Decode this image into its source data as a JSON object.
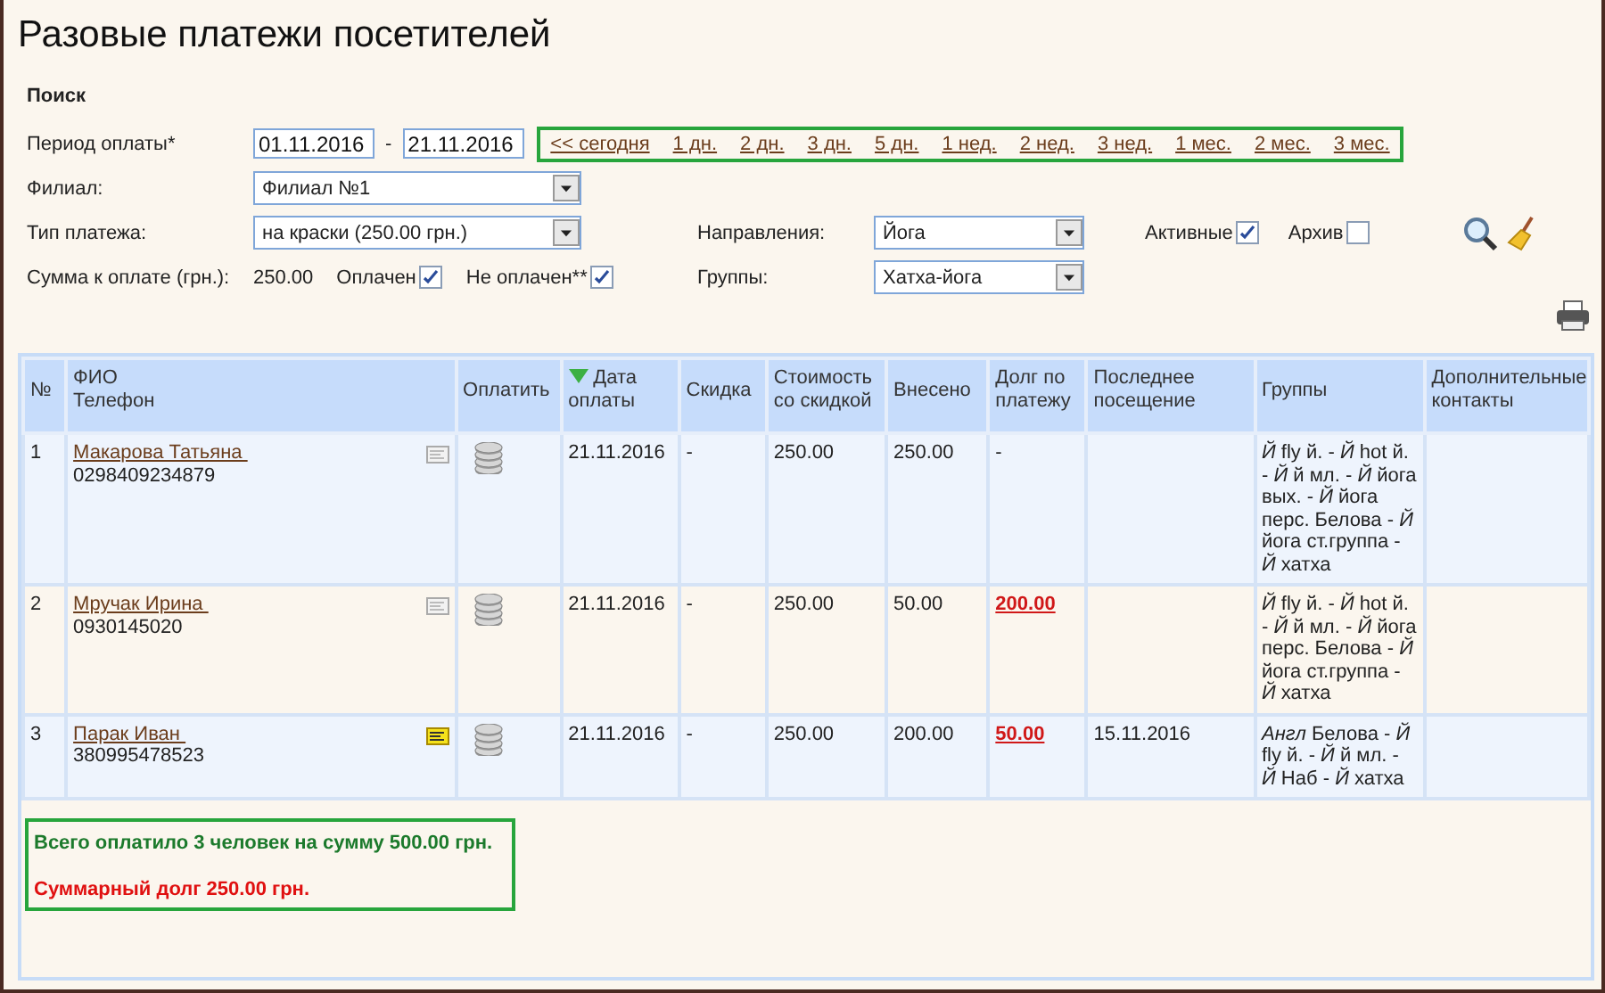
{
  "title": "Разовые платежи посетителей",
  "filters": {
    "heading": "Поиск",
    "period": {
      "label": "Период оплаты*",
      "from": "01.11.2016",
      "separator": "-",
      "to": "21.11.2016"
    },
    "quick_ranges": [
      "<<  сегодня",
      "1 дн.",
      "2 дн.",
      "3 дн.",
      "5 дн.",
      "1 нед.",
      "2 нед.",
      "3 нед.",
      "1 мес.",
      "2 мес.",
      "3 мес."
    ],
    "branch": {
      "label": "Филиал:",
      "value": "Филиал №1"
    },
    "payment_type": {
      "label": "Тип платежа:",
      "value": "на краски (250.00 грн.)"
    },
    "amount": {
      "label": "Сумма к оплате (грн.):",
      "value": "250.00"
    },
    "paid": {
      "label": "Оплачен",
      "checked": true
    },
    "unpaid": {
      "label": "Не оплачен**",
      "checked": true
    },
    "directions": {
      "label": "Направления:",
      "value": "Йога"
    },
    "groups": {
      "label": "Группы:",
      "value": "Хатха-йога"
    },
    "active": {
      "label": "Активные",
      "checked": true
    },
    "archive": {
      "label": "Архив",
      "checked": false
    }
  },
  "table": {
    "columns": [
      {
        "label": "№",
        "sorted": false
      },
      {
        "label": "ФИО\nТелефон",
        "sorted": false
      },
      {
        "label": "Оплатить",
        "sorted": false
      },
      {
        "label": "Дата оплаты",
        "sorted": true
      },
      {
        "label": "Скидка",
        "sorted": false
      },
      {
        "label": "Стоимость со скидкой",
        "sorted": false
      },
      {
        "label": "Внесено",
        "sorted": false
      },
      {
        "label": "Долг по платежу",
        "sorted": false
      },
      {
        "label": "Последнее посещение",
        "sorted": false
      },
      {
        "label": "Группы",
        "sorted": false
      },
      {
        "label": "Дополнительные контакты",
        "sorted": false
      }
    ],
    "rows": [
      {
        "number": "1",
        "name": "Макарова Татьяна ",
        "phone": "0298409234879",
        "has_note": false,
        "date": "21.11.2016",
        "discount": "-",
        "cost": "250.00",
        "paid": "250.00",
        "debt": {
          "text": "-",
          "highlighted": false
        },
        "last_visit": "",
        "groups": "*Й* fly й. - *Й* hot й. - *Й* й мл. - *Й* йога вых. - *Й* йога перс. Белова - *Й* йога ст.группа - *Й* хатха"
      },
      {
        "number": "2",
        "name": "Мручак Ирина ",
        "phone": "0930145020",
        "has_note": false,
        "date": "21.11.2016",
        "discount": "-",
        "cost": "250.00",
        "paid": "50.00",
        "debt": {
          "text": "200.00",
          "highlighted": true
        },
        "last_visit": "",
        "groups": "*Й* fly й. - *Й* hot й. - *Й* й мл. - *Й* йога перс. Белова - *Й* йога ст.группа - *Й* хатха"
      },
      {
        "number": "3",
        "name": "Парак Иван ",
        "phone": "380995478523",
        "has_note": true,
        "date": "21.11.2016",
        "discount": "-",
        "cost": "250.00",
        "paid": "200.00",
        "debt": {
          "text": "50.00",
          "highlighted": true
        },
        "last_visit": "15.11.2016",
        "groups": "*Англ* Белова - *Й* fly й. - *Й* й мл. - *Й* Наб - *Й* хатха"
      }
    ]
  },
  "summary": [
    {
      "kind": "paid",
      "text": "Всего оплатило 3 человек на сумму 500.00 грн."
    },
    {
      "kind": "debt",
      "text": "Суммарный долг 250.00 грн."
    }
  ]
}
